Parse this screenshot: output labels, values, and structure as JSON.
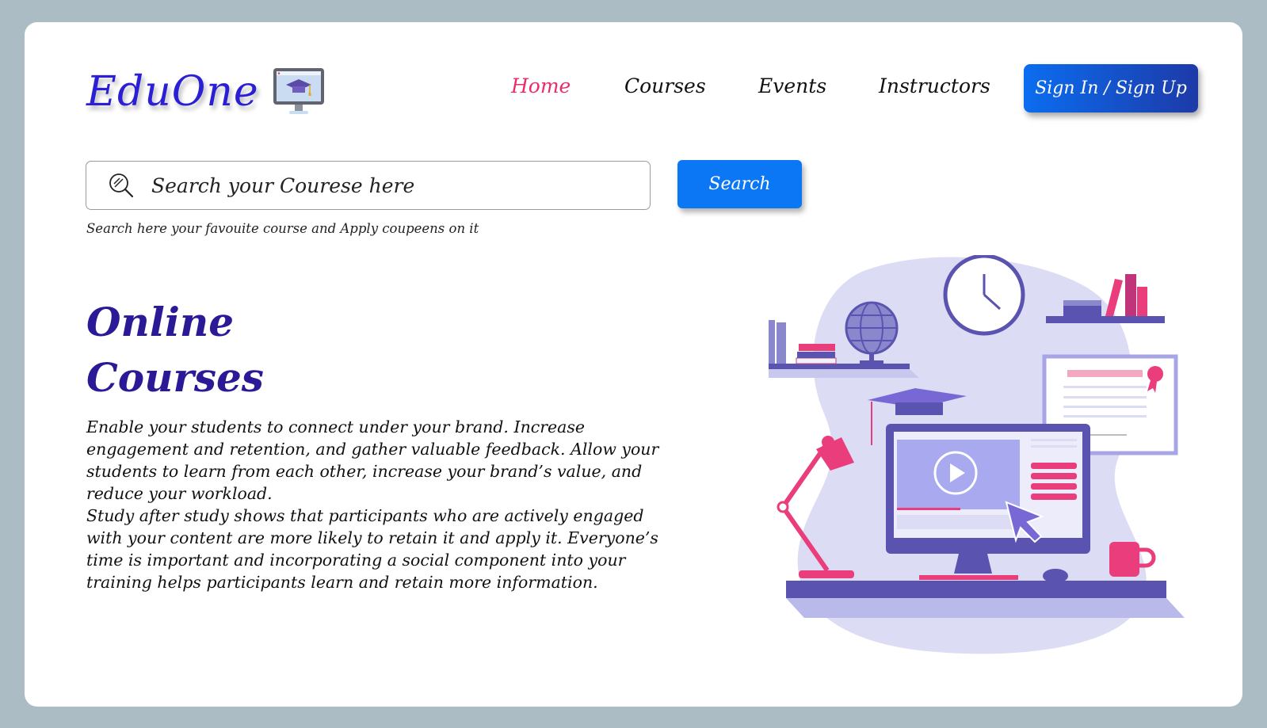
{
  "brand": {
    "name": "EduOne",
    "icon": "monitor-graduation-cap-icon"
  },
  "nav": {
    "items": [
      {
        "label": "Home",
        "active": true
      },
      {
        "label": "Courses",
        "active": false
      },
      {
        "label": "Events",
        "active": false
      },
      {
        "label": "Instructors",
        "active": false
      }
    ],
    "signin_label": "Sign In / Sign Up"
  },
  "search": {
    "placeholder": "Search your Courese here",
    "button_label": "Search",
    "hint": "Search here your favouite course and Apply coupeens on it",
    "icon": "search-icon"
  },
  "hero": {
    "title_line1": "Online",
    "title_line2": "Courses",
    "paragraph1": "Enable your students to connect under your brand. Increase engagement and retention, and gather valuable feedback. Allow your students to learn from each other, increase your brand’s value, and reduce your workload.",
    "paragraph2": "Study after study shows that participants who are actively engaged with your content are more likely to retain it and apply it. Everyone’s time is important and incorporating a social component into your training helps participants learn and retain more information."
  },
  "colors": {
    "background": "#abbcc5",
    "brand": "#2a1fd6",
    "nav_active": "#ea2c6b",
    "button": "#0b77f5",
    "headline": "#2a1a96"
  }
}
